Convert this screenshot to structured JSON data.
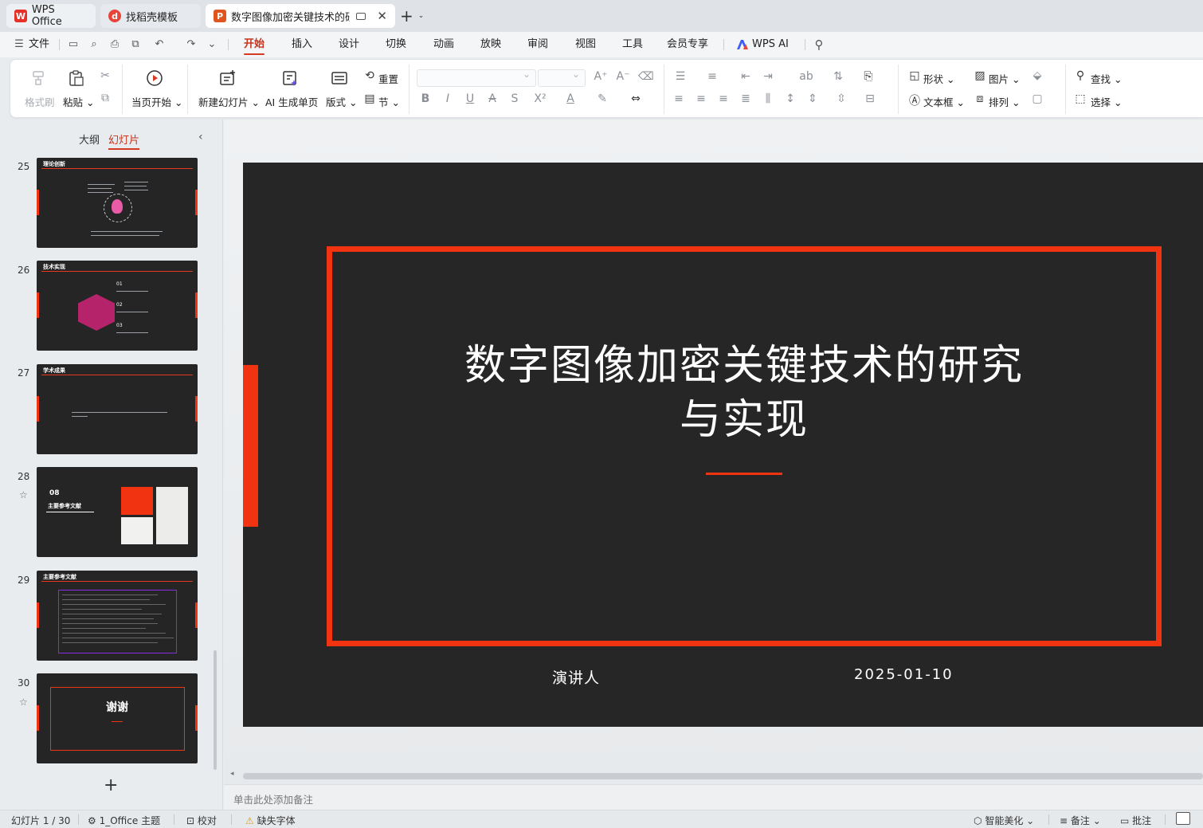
{
  "tabs": {
    "home": "WPS Office",
    "templates": "找稻壳模板",
    "document": "数字图像加密关键技术的研究与实现"
  },
  "menu": {
    "file": "文件",
    "items": [
      "开始",
      "插入",
      "设计",
      "切换",
      "动画",
      "放映",
      "审阅",
      "视图",
      "工具",
      "会员专享"
    ],
    "ai": "WPS AI"
  },
  "ribbon": {
    "format_painter": "格式刷",
    "paste": "粘贴",
    "from_current": "当页开始",
    "new_slide": "新建幻灯片",
    "ai_single": "AI 生成单页",
    "layout": "版式",
    "reset": "重置",
    "section": "节",
    "shape": "形状",
    "picture": "图片",
    "textbox": "文本框",
    "arrange": "排列",
    "find": "查找",
    "select": "选择"
  },
  "panel": {
    "outline_tab": "大纲",
    "slides_tab": "幻灯片"
  },
  "thumbnails": [
    {
      "num": "25",
      "title": "理论创新"
    },
    {
      "num": "26",
      "title": "技术实现",
      "items": [
        "01",
        "02",
        "03"
      ]
    },
    {
      "num": "27",
      "title": "学术成果"
    },
    {
      "num": "28",
      "section_num": "08",
      "section_title": "主要参考文献"
    },
    {
      "num": "29",
      "title": "主要参考文献"
    },
    {
      "num": "30",
      "thanks": "谢谢"
    }
  ],
  "slide": {
    "title_line1": "数字图像加密关键技术的研究",
    "title_line2": "与实现",
    "speaker": "演讲人",
    "date": "2025-01-10"
  },
  "notes_placeholder": "单击此处添加备注",
  "status": {
    "slide_counter": "幻灯片 1 / 30",
    "theme": "1_Office 主题",
    "proof": "校对",
    "missing_font": "缺失字体",
    "beautify": "智能美化",
    "notes": "备注",
    "comments": "批注"
  },
  "colors": {
    "accent": "#f23312",
    "slide_bg": "#262626",
    "menu_active": "#c8331c"
  }
}
